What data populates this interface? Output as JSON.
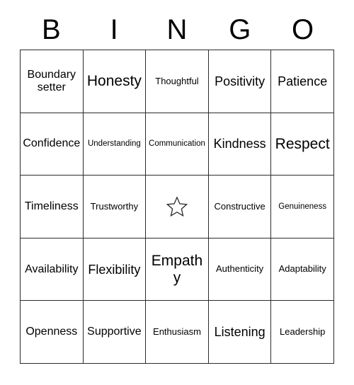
{
  "card": {
    "headers": [
      "B",
      "I",
      "N",
      "G",
      "O"
    ],
    "free_space_icon": "star-outline-icon",
    "border_color": "#2b2b2b",
    "background_color": "#ffffff",
    "text_color": "#000000",
    "rows": [
      [
        {
          "label": "Boundary setter",
          "size": "md"
        },
        {
          "label": "Honesty",
          "size": "xl"
        },
        {
          "label": "Thoughtful",
          "size": "sm"
        },
        {
          "label": "Positivity",
          "size": "lg"
        },
        {
          "label": "Patience",
          "size": "lg"
        }
      ],
      [
        {
          "label": "Confidence",
          "size": "md"
        },
        {
          "label": "Understanding",
          "size": "xs"
        },
        {
          "label": "Communication",
          "size": "xs"
        },
        {
          "label": "Kindness",
          "size": "lg"
        },
        {
          "label": "Respect",
          "size": "xl"
        }
      ],
      [
        {
          "label": "Timeliness",
          "size": "md"
        },
        {
          "label": "Trustworthy",
          "size": "sm"
        },
        {
          "label": "",
          "size": "md",
          "free": true
        },
        {
          "label": "Constructive",
          "size": "sm"
        },
        {
          "label": "Genuineness",
          "size": "xs"
        }
      ],
      [
        {
          "label": "Availability",
          "size": "md"
        },
        {
          "label": "Flexibility",
          "size": "lg"
        },
        {
          "label": "Empathy",
          "size": "xl"
        },
        {
          "label": "Authenticity",
          "size": "sm"
        },
        {
          "label": "Adaptability",
          "size": "sm"
        }
      ],
      [
        {
          "label": "Openness",
          "size": "md"
        },
        {
          "label": "Supportive",
          "size": "md"
        },
        {
          "label": "Enthusiasm",
          "size": "sm"
        },
        {
          "label": "Listening",
          "size": "lg"
        },
        {
          "label": "Leadership",
          "size": "sm"
        }
      ]
    ]
  }
}
